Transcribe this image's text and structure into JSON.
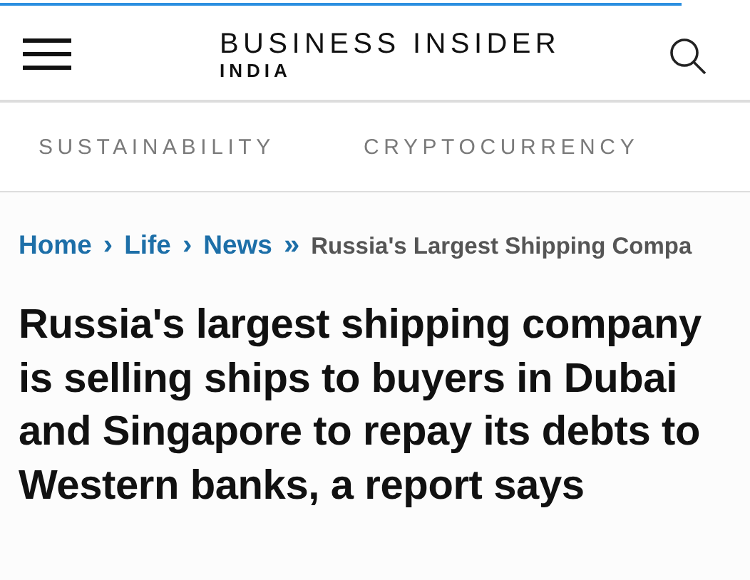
{
  "brand": {
    "name": "BUSINESS INSIDER",
    "edition": "INDIA"
  },
  "nav": [
    "SUSTAINABILITY",
    "CRYPTOCURRENCY"
  ],
  "breadcrumb": [
    {
      "label": "Home",
      "separator": "›",
      "kind": "link"
    },
    {
      "label": "Life",
      "separator": "›",
      "kind": "link"
    },
    {
      "label": "News",
      "separator": "»",
      "kind": "link"
    },
    {
      "label": "Russia's Largest Shipping Compa",
      "kind": "current"
    }
  ],
  "headline": "Russia's largest shipping company is selling ships to buyers in Dubai and Singapore to repay its debts to Western banks, a report says"
}
